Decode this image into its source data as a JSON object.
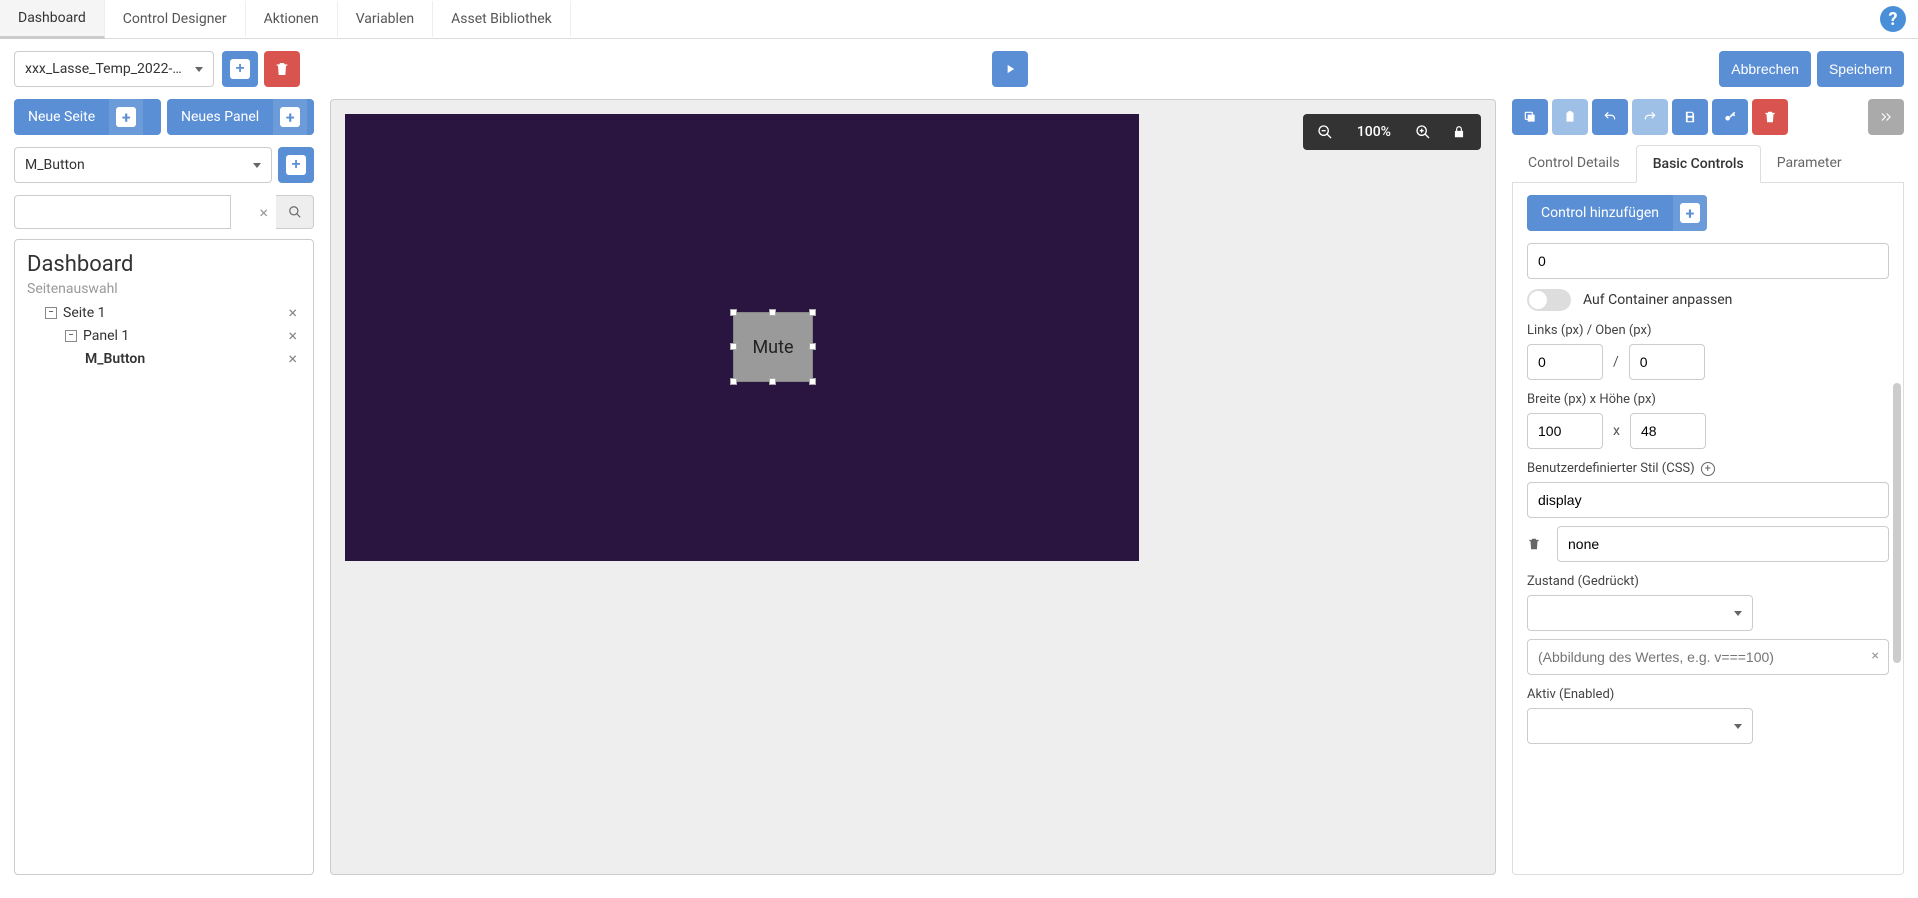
{
  "top_tabs": {
    "dashboard": "Dashboard",
    "control_designer": "Control Designer",
    "aktionen": "Aktionen",
    "variablen": "Variablen",
    "asset_bibliothek": "Asset Bibliothek"
  },
  "toolbar": {
    "dashboard_select": "xxx_Lasse_Temp_2022-11-...",
    "cancel": "Abbrechen",
    "save": "Speichern"
  },
  "left": {
    "new_page": "Neue Seite",
    "new_panel": "Neues Panel",
    "control_type": "M_Button",
    "tree_title": "Dashboard",
    "tree_sub": "Seitenauswahl",
    "page1": "Seite 1",
    "panel1": "Panel 1",
    "mbutton": "M_Button"
  },
  "canvas": {
    "zoom": "100%",
    "control_label": "Mute"
  },
  "right": {
    "tabs": {
      "control_details": "Control Details",
      "basic_controls": "Basic Controls",
      "parameter": "Parameter"
    },
    "add_control": "Control hinzufügen",
    "value0": "0",
    "fit_container": "Auf Container anpassen",
    "links_oben_label": "Links (px) / Oben (px)",
    "links": "0",
    "oben": "0",
    "sep_slash": "/",
    "breite_hoehe_label": "Breite (px) x Höhe (px)",
    "breite": "100",
    "hoehe": "48",
    "sep_x": "x",
    "css_label": "Benutzerdefinierter Stil (CSS)",
    "css_prop": "display",
    "css_val": "none",
    "zustand_label": "Zustand (Gedrückt)",
    "mapping_placeholder": "(Abbildung des Wertes, e.g. v===100)",
    "aktiv_label": "Aktiv (Enabled)"
  }
}
